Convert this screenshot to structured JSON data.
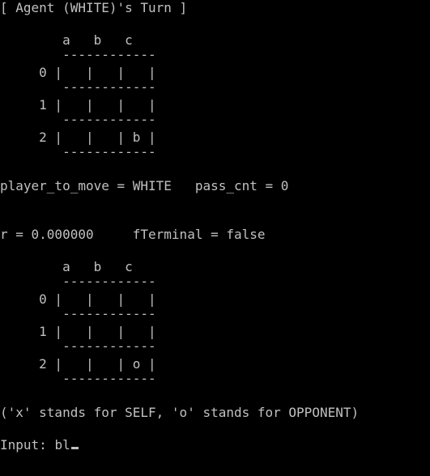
{
  "colors": {
    "background": "#000000",
    "text": "#c0c0c0"
  },
  "console": {
    "header": "[ Agent (WHITE)'s Turn ]",
    "board1": {
      "col_labels": "        a   b   c",
      "separator": "        ------------",
      "rows": [
        "     0 |   |   |   |",
        "     1 |   |   |   |",
        "     2 |   |   | b |"
      ]
    },
    "status_line": "player_to_move = WHITE   pass_cnt = 0",
    "reward_line": "r = 0.000000     fTerminal = false",
    "board2": {
      "col_labels": "        a   b   c",
      "separator": "        ------------",
      "rows": [
        "     0 |   |   |   |",
        "     1 |   |   |   |",
        "     2 |   |   | o |"
      ]
    },
    "legend": "('x' stands for SELF, 'o' stands for OPPONENT)",
    "prompt": "Input: ",
    "input_value": "bl"
  }
}
